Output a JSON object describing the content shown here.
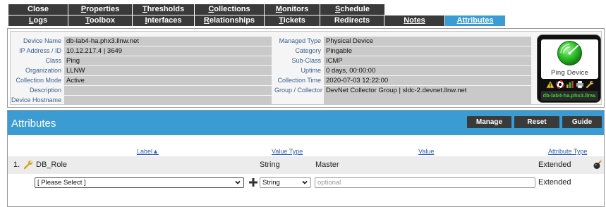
{
  "tabs": {
    "row1": [
      {
        "label": "Close",
        "underline": "",
        "active": false
      },
      {
        "label": "Properties",
        "underline": "P",
        "active": false
      },
      {
        "label": "Thresholds",
        "underline": "T",
        "active": false
      },
      {
        "label": "Collections",
        "underline": "C",
        "active": false
      },
      {
        "label": "Monitors",
        "underline": "M",
        "active": false
      },
      {
        "label": "Schedule",
        "underline": "S",
        "active": false
      }
    ],
    "row2": [
      {
        "label": "Logs",
        "underline": "L",
        "active": false
      },
      {
        "label": "Toolbox",
        "underline": "T",
        "active": false
      },
      {
        "label": "Interfaces",
        "underline": "I",
        "active": false
      },
      {
        "label": "Relationships",
        "underline": "R",
        "active": false
      },
      {
        "label": "Tickets",
        "underline": "T",
        "active": false
      },
      {
        "label": "Redirects",
        "underline": "",
        "active": false
      },
      {
        "label": "Notes",
        "underline": "N",
        "active": false
      },
      {
        "label": "Attributes",
        "underline": "A",
        "active": true
      }
    ]
  },
  "device_info": {
    "left_fields": [
      {
        "label": "Device Name",
        "value": "db-lab4-ha.phx3.llnw.net"
      },
      {
        "label": "IP Address / ID",
        "value": "10.12.217.4 | 3649"
      },
      {
        "label": "Class",
        "value": "Ping"
      },
      {
        "label": "Organization",
        "value": "LLNW"
      },
      {
        "label": "Collection Mode",
        "value": "Active"
      },
      {
        "label": "Description",
        "value": ""
      },
      {
        "label": "Device Hostname",
        "value": ""
      }
    ],
    "right_fields": [
      {
        "label": "Managed Type",
        "value": "Physical Device"
      },
      {
        "label": "Category",
        "value": "Pingable"
      },
      {
        "label": "Sub-Class",
        "value": "ICMP"
      },
      {
        "label": "Uptime",
        "value": "0 days, 00:00:00"
      },
      {
        "label": "Collection Time",
        "value": "2020-07-03 12:22:00"
      },
      {
        "label": "Group / Collector",
        "value": "DevNet Collector Group | sldc-2.devnet.llnw.net"
      }
    ],
    "badge": {
      "device_type": "Ping Device",
      "device_name": "db-lab4-ha.phx3.llnw.",
      "status_color": "#2fc32a",
      "tool_icons": [
        "warning-icon",
        "lifebuoy-icon",
        "bar-chart-icon",
        "printer-icon",
        "wrench-icon"
      ]
    }
  },
  "attributes": {
    "title": "Attributes",
    "buttons": {
      "manage": "Manage",
      "reset": "Reset",
      "guide": "Guide"
    },
    "columns": {
      "label": "Label▲",
      "value_type": "Value Type",
      "value": "Value",
      "attribute_type": "Attribute Type"
    },
    "rows": [
      {
        "index": "1.",
        "label": "DB_Role",
        "value_type": "String",
        "value": "Master",
        "attribute_type": "Extended"
      }
    ],
    "new_row": {
      "label_select": "[ Please Select ]",
      "type_select": "String",
      "value_placeholder": "optional",
      "attribute_type": "Extended"
    }
  },
  "colors": {
    "accent": "#3b9bd3",
    "tab_bg": "#3a3a3a",
    "field_bg": "#c9c9c9",
    "label_blue": "#3a5f8f"
  }
}
